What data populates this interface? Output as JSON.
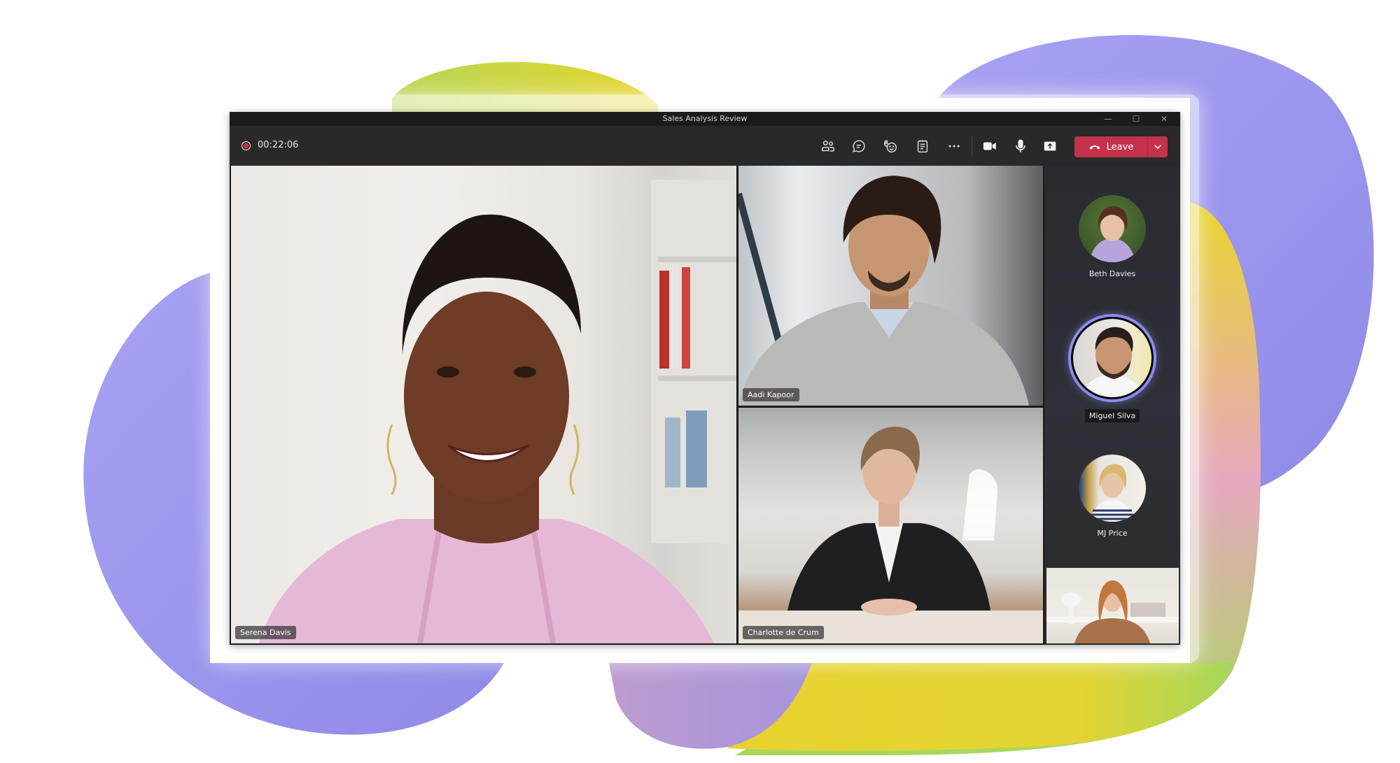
{
  "window": {
    "title": "Sales Analysis Review",
    "controls": {
      "minimize": "—",
      "maximize": "☐",
      "close": "✕"
    }
  },
  "toolbar": {
    "recording_indicator": "record-icon",
    "timer": "00:22:06",
    "buttons": [
      {
        "name": "people",
        "icon": "people-icon"
      },
      {
        "name": "chat",
        "icon": "chat-icon"
      },
      {
        "name": "reactions",
        "icon": "raise-hand-reaction-icon"
      },
      {
        "name": "notes",
        "icon": "notes-icon"
      },
      {
        "name": "more",
        "icon": "more-options-icon"
      },
      {
        "name": "camera",
        "icon": "camera-icon"
      },
      {
        "name": "mic",
        "icon": "microphone-icon"
      },
      {
        "name": "share",
        "icon": "share-screen-icon"
      }
    ],
    "leave_label": "Leave",
    "leave_icon": "hang-up-icon",
    "leave_color": "#c4314b"
  },
  "participants": {
    "main": {
      "name": "Serena Davis"
    },
    "grid": [
      {
        "name": "Aadi Kapoor"
      },
      {
        "name": "Charlotte de Crum"
      }
    ],
    "side": [
      {
        "name": "Beth Davies",
        "speaking": false
      },
      {
        "name": "Miguel Silva",
        "speaking": true
      },
      {
        "name": "MJ Price",
        "speaking": false
      }
    ],
    "self_view": {
      "name": ""
    }
  },
  "colors": {
    "speaking_ring": "#8b8cf0",
    "background_purple": "#9c95ee",
    "background_yellow": "#e8d330",
    "background_green": "#a8d857",
    "background_pink": "#e0a8c0"
  }
}
